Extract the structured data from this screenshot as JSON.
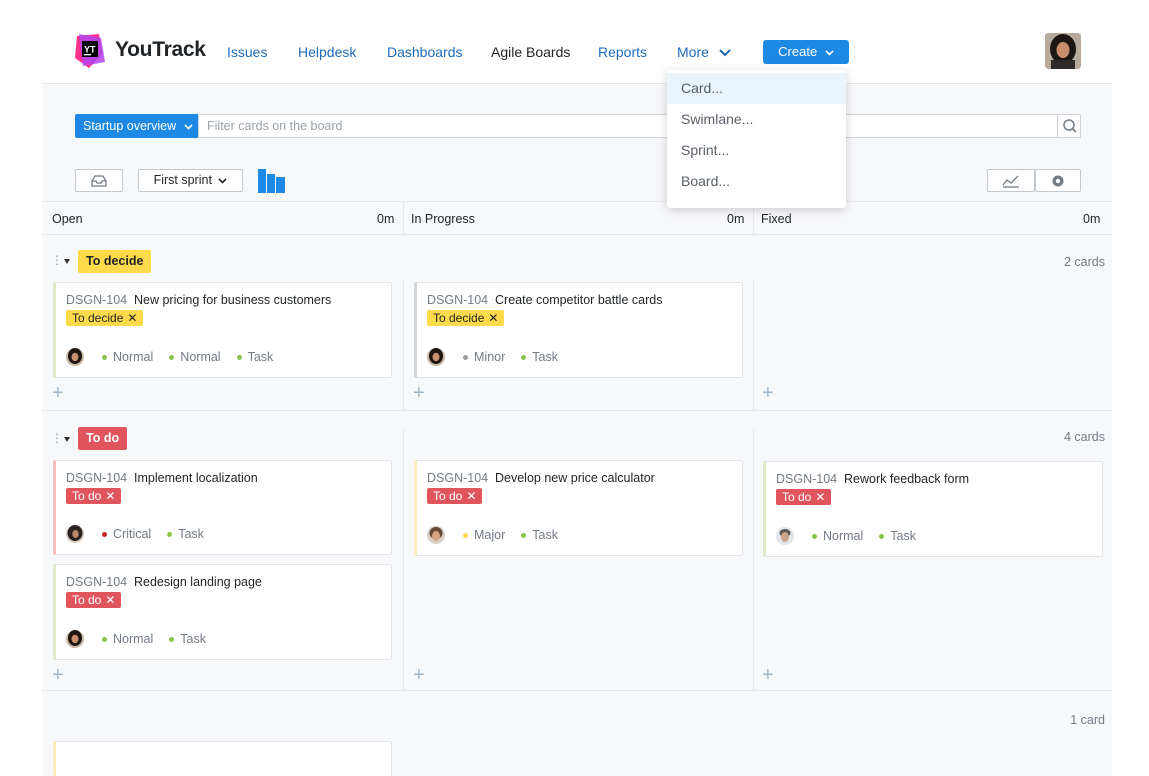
{
  "header": {
    "brand": "YouTrack",
    "logo_text": "YT",
    "nav": [
      "Issues",
      "Helpdesk",
      "Dashboards",
      "Agile Boards",
      "Reports"
    ],
    "more_label": "More",
    "create_label": "Create"
  },
  "dropdown": {
    "items": [
      "Card...",
      "Swimlane...",
      "Sprint...",
      "Board..."
    ]
  },
  "search": {
    "board_name": "Startup overview",
    "placeholder": "Filter cards on the board"
  },
  "toolbar": {
    "sprint_label": "First sprint"
  },
  "columns": [
    {
      "name": "Open",
      "estimate": "0m"
    },
    {
      "name": "In Progress",
      "estimate": "0m"
    },
    {
      "name": "Fixed",
      "estimate": "0m"
    }
  ],
  "lanes": [
    {
      "tag": "To decide",
      "count": "2 cards",
      "cards": [
        {
          "id": "DSGN-104",
          "title": "New pricing for business customers",
          "tag": "To decide",
          "fields": [
            "Normal",
            "Normal",
            "Task"
          ]
        },
        {
          "id": "DSGN-104",
          "title": "Create competitor battle cards",
          "tag": "To decide",
          "fields": [
            "Minor",
            "Task"
          ]
        }
      ]
    },
    {
      "tag": "To do",
      "count": "4 cards",
      "cards": [
        {
          "id": "DSGN-104",
          "title": "Implement localization",
          "tag": "To do",
          "fields": [
            "Critical",
            "Task"
          ]
        },
        {
          "id": "DSGN-104",
          "title": "Redesign landing page",
          "tag": "To do",
          "fields": [
            "Normal",
            "Task"
          ]
        },
        {
          "id": "DSGN-104",
          "title": "Develop new price calculator",
          "tag": "To do",
          "fields": [
            "Major",
            "Task"
          ]
        },
        {
          "id": "DSGN-104",
          "title": "Rework feedback form",
          "tag": "To do",
          "fields": [
            "Normal",
            "Task"
          ]
        }
      ]
    },
    {
      "count": "1 card"
    }
  ],
  "colors": {
    "accent": "#1e88e5",
    "tag_yellow": "#ffda4a",
    "tag_red": "#e0545c",
    "priority_normal": "#8bc34a",
    "priority_minor": "#9e9e9e",
    "priority_critical": "#c62828",
    "priority_major": "#ffd54f",
    "type_task": "#8bc34a"
  }
}
